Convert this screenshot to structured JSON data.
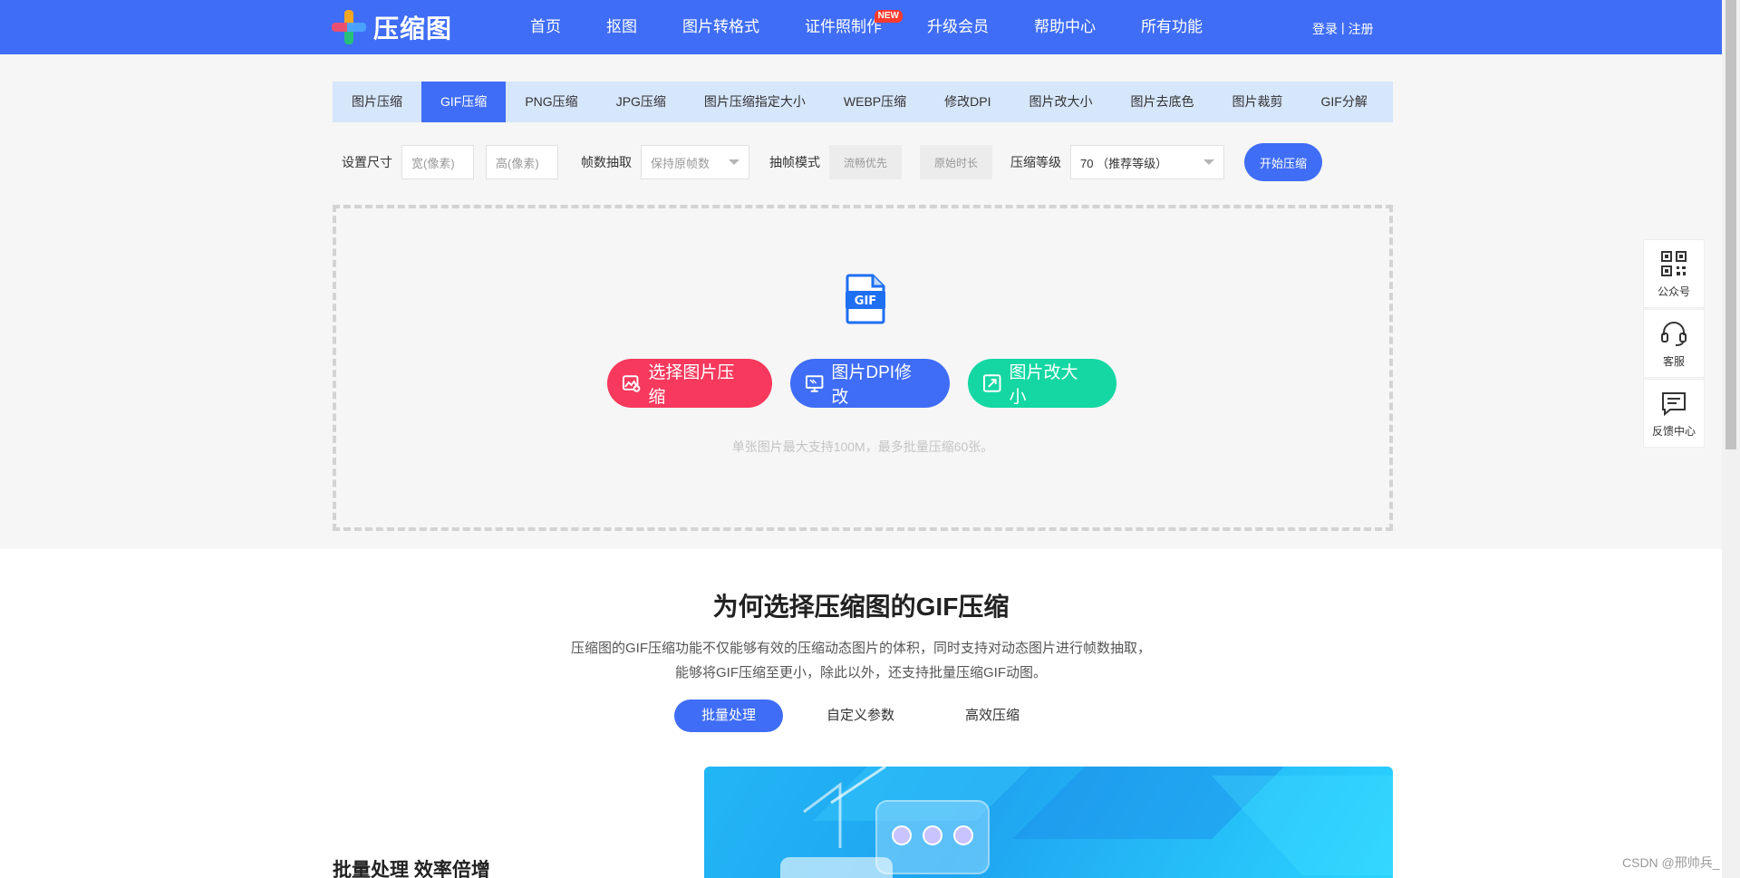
{
  "header": {
    "logo_text": "压缩图",
    "nav": [
      {
        "label": "首页"
      },
      {
        "label": "抠图"
      },
      {
        "label": "图片转格式"
      },
      {
        "label": "证件照制作",
        "badge": "NEW"
      },
      {
        "label": "升级会员"
      },
      {
        "label": "帮助中心"
      },
      {
        "label": "所有功能"
      }
    ],
    "login": "登录",
    "separator": "|",
    "register": "注册"
  },
  "tabs": [
    {
      "label": "图片压缩"
    },
    {
      "label": "GIF压缩",
      "active": true
    },
    {
      "label": "PNG压缩"
    },
    {
      "label": "JPG压缩"
    },
    {
      "label": "图片压缩指定大小"
    },
    {
      "label": "WEBP压缩"
    },
    {
      "label": "修改DPI"
    },
    {
      "label": "图片改大小"
    },
    {
      "label": "图片去底色"
    },
    {
      "label": "图片裁剪"
    },
    {
      "label": "GIF分解"
    }
  ],
  "settings": {
    "size_label": "设置尺寸",
    "width_placeholder": "宽(像素)",
    "height_placeholder": "高(像素)",
    "frame_label": "帧数抽取",
    "frame_value": "保持原帧数",
    "mode_label": "抽帧模式",
    "mode_smooth": "流畅优先",
    "mode_original": "原始时长",
    "level_label": "压缩等级",
    "level_value": "70 （推荐等级）",
    "start_button": "开始压缩"
  },
  "dropzone": {
    "file_icon_text": "GIF",
    "select_button": "选择图片压缩",
    "dpi_button": "图片DPI修改",
    "resize_button": "图片改大小",
    "hint": "单张图片最大支持100M，最多批量压缩60张。"
  },
  "side_panel": [
    {
      "label": "公众号",
      "icon": "qrcode-icon"
    },
    {
      "label": "客服",
      "icon": "headset-icon"
    },
    {
      "label": "反馈中心",
      "icon": "feedback-icon"
    }
  ],
  "intro": {
    "title": "为何选择压缩图的GIF压缩",
    "desc_line1": "压缩图的GIF压缩功能不仅能够有效的压缩动态图片的体积，同时支持对动态图片进行帧数抽取，",
    "desc_line2": "能够将GIF压缩至更小，除此以外，还支持批量压缩GIF动图。",
    "tabs": [
      {
        "label": "批量处理",
        "active": true
      },
      {
        "label": "自定义参数"
      },
      {
        "label": "高效压缩"
      }
    ],
    "feature_title": "批量处理 效率倍增"
  },
  "watermark": "CSDN @邢帅兵_",
  "colors": {
    "primary": "#3f6df6",
    "red": "#f6395c",
    "green": "#15d7a3",
    "tab_bg": "#d6e6fb"
  }
}
